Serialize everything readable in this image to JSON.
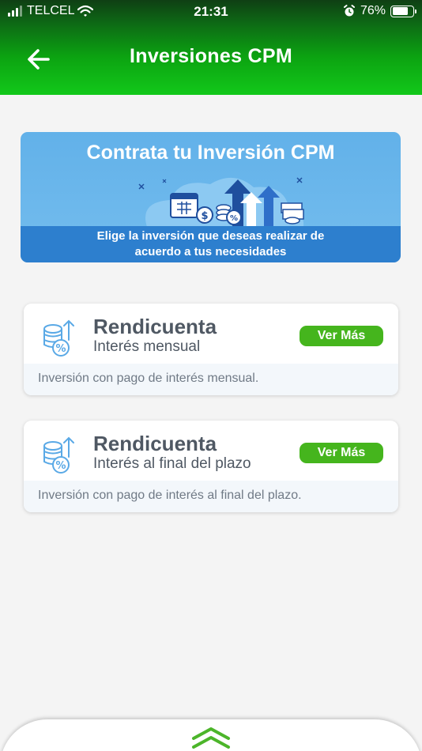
{
  "status_bar": {
    "carrier": "TELCEL",
    "time": "21:31",
    "battery_percent": "76%",
    "battery_level": 0.76
  },
  "header": {
    "title": "Inversiones CPM",
    "back_icon": "arrow-left-icon"
  },
  "banner": {
    "title": "Contrata tu Inversión CPM",
    "caption_line1": "Elige la inversión que deseas realizar de",
    "caption_line2": "acuerdo a tus necesidades"
  },
  "products": [
    {
      "name": "Rendicuenta",
      "subtitle": "Interés mensual",
      "button": "Ver Más",
      "description": "Inversión con pago de interés mensual."
    },
    {
      "name": "Rendicuenta",
      "subtitle": "Interés al final del plazo",
      "button": "Ver Más",
      "description": "Inversión con pago de interés al final del plazo."
    }
  ],
  "colors": {
    "header_green": "#0ca311",
    "button_green": "#45b51d",
    "banner_blue": "#62b1e9",
    "banner_strip_blue": "#2d7fce",
    "text_gray": "#4f5863"
  }
}
